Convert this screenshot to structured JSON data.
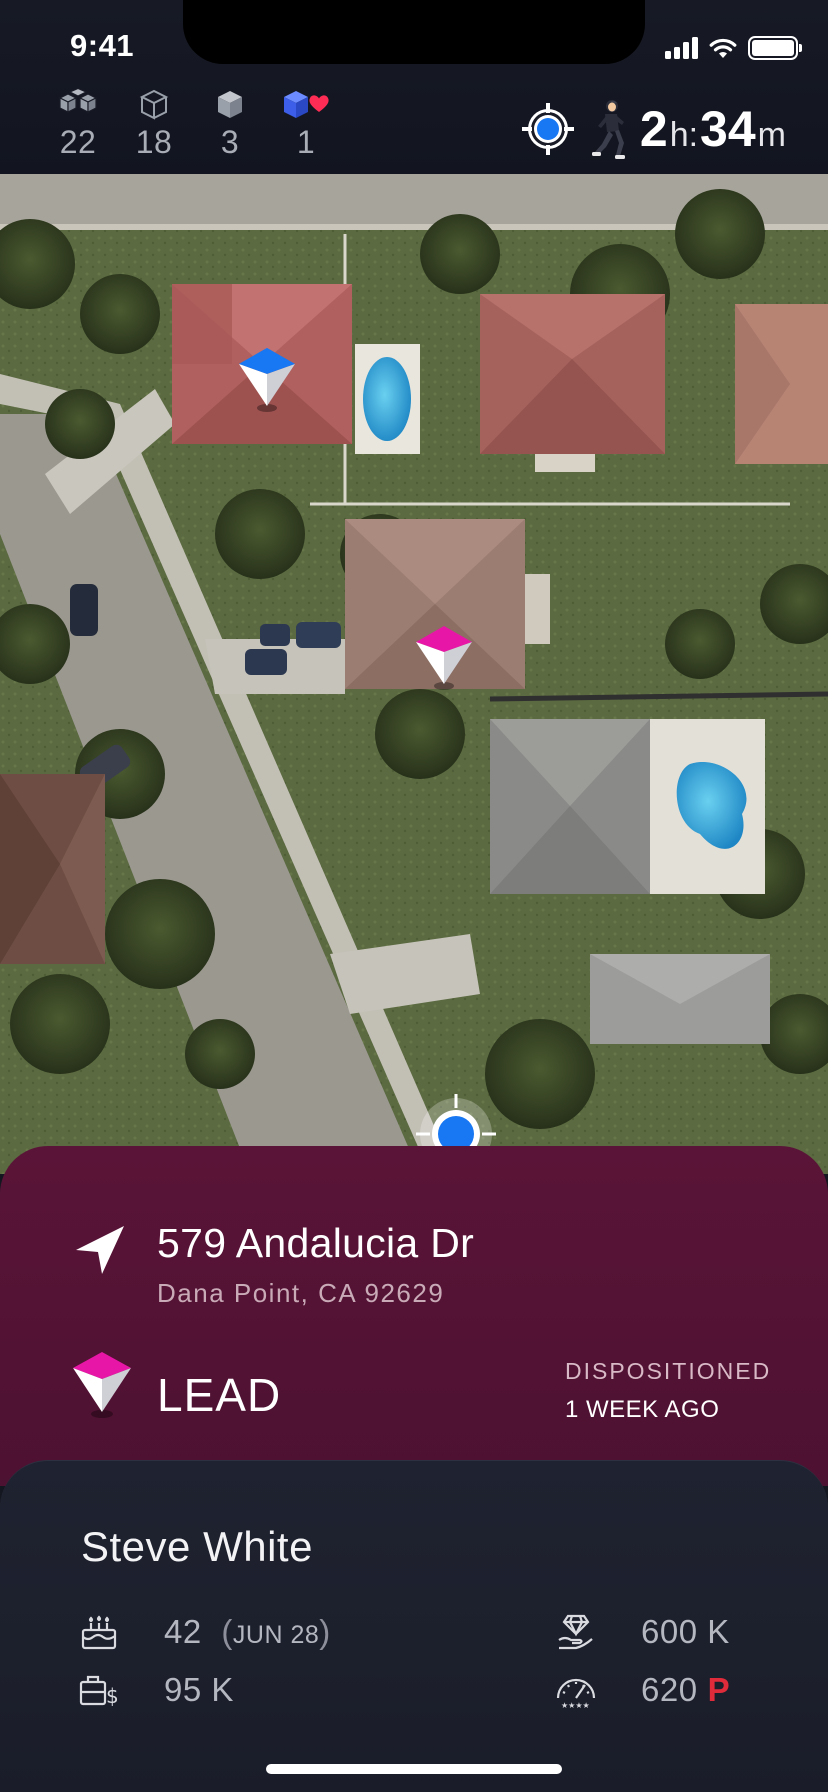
{
  "status_bar": {
    "time": "9:41"
  },
  "header": {
    "counts": [
      {
        "icon": "boxes-stack-icon",
        "value": "22"
      },
      {
        "icon": "box-outline-icon",
        "value": "18"
      },
      {
        "icon": "box-solid-icon",
        "value": "3"
      },
      {
        "icon": "box-heart-icon",
        "value": "1"
      }
    ],
    "timer": {
      "hours": "2",
      "hours_unit": "h:",
      "minutes": "34",
      "minutes_unit": "m"
    }
  },
  "property": {
    "address": "579 Andalucia Dr",
    "city": "Dana Point, CA 92629",
    "status": "LEAD",
    "disposition_label": "DISPOSITIONED",
    "disposition_time": "1 WEEK AGO"
  },
  "person": {
    "name": "Steve White",
    "age": "42",
    "birthday": "JUN 28",
    "income": "95 K",
    "home_value": "600 K",
    "credit_score": "620",
    "credit_flag": "P"
  },
  "colors": {
    "accent_blue": "#1877f2",
    "lead_pink": "#e816a6",
    "card_maroon": "#5a1437",
    "credit_flag_red": "#e02b3b"
  }
}
